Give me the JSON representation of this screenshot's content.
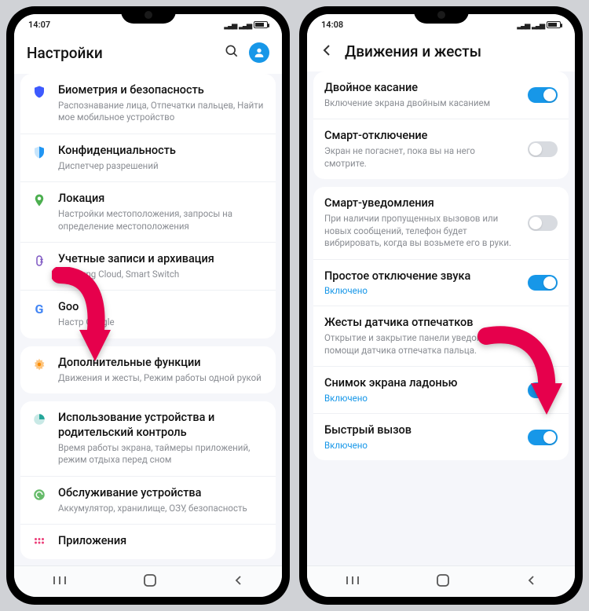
{
  "left": {
    "time": "14:07",
    "title": "Настройки",
    "items": [
      {
        "icon": "shield-icon",
        "title": "Биометрия и безопасность",
        "sub": "Распознавание лица, Отпечатки пальцев, Найти мое мобильное устройство"
      },
      {
        "icon": "privacy-icon",
        "title": "Конфиденциальность",
        "sub": "Диспетчер разрешений"
      },
      {
        "icon": "location-icon",
        "title": "Локация",
        "sub": "Настройки местоположения, запросы на определение местоположения"
      },
      {
        "icon": "accounts-icon",
        "title": "Учетные записи и архивация",
        "sub": "Samsung Cloud, Smart Switch"
      },
      {
        "icon": "google-icon",
        "title": "Goo",
        "sub": "Настр            Google"
      }
    ],
    "advanced": [
      {
        "icon": "advanced-icon",
        "title": "Дополнительные функции",
        "sub": "Движения и жесты, Режим работы одной рукой"
      }
    ],
    "care": [
      {
        "icon": "usage-icon",
        "title": "Использование устройства и родительский контроль",
        "sub": "Время работы экрана, таймеры приложений, режим отдыха перед сном"
      },
      {
        "icon": "care-icon",
        "title": "Обслуживание устройства",
        "sub": "Аккумулятор, хранилище, ОЗУ, безопасность"
      },
      {
        "icon": "apps-icon",
        "title": "Приложения",
        "sub": ""
      }
    ]
  },
  "right": {
    "time": "14:08",
    "title": "Движения и жесты",
    "group1": [
      {
        "title": "Двойное касание",
        "sub": "Включение экрана двойным касанием",
        "on": true
      },
      {
        "title": "Смарт-отключение",
        "sub": "Экран не погаснет, пока вы на него смотрите.",
        "on": false
      }
    ],
    "group2": [
      {
        "title": "Смарт-уведомления",
        "sub": "При наличии пропущенных вызовов или новых сообщений, телефон будет вибрировать, когда вы возьмете его в руки.",
        "on": false
      },
      {
        "title": "Простое отключение звука",
        "state": "Включено",
        "on": true
      },
      {
        "title": "Жесты датчика отпечатков",
        "sub": "Открытие и закрытие панели уведомлений при помощи датчика отпечатка пальца."
      },
      {
        "title": "Снимок экрана ладонью",
        "state": "Включено",
        "on": true
      },
      {
        "title": "Быстрый вызов",
        "state": "Включено",
        "on": true
      }
    ]
  }
}
